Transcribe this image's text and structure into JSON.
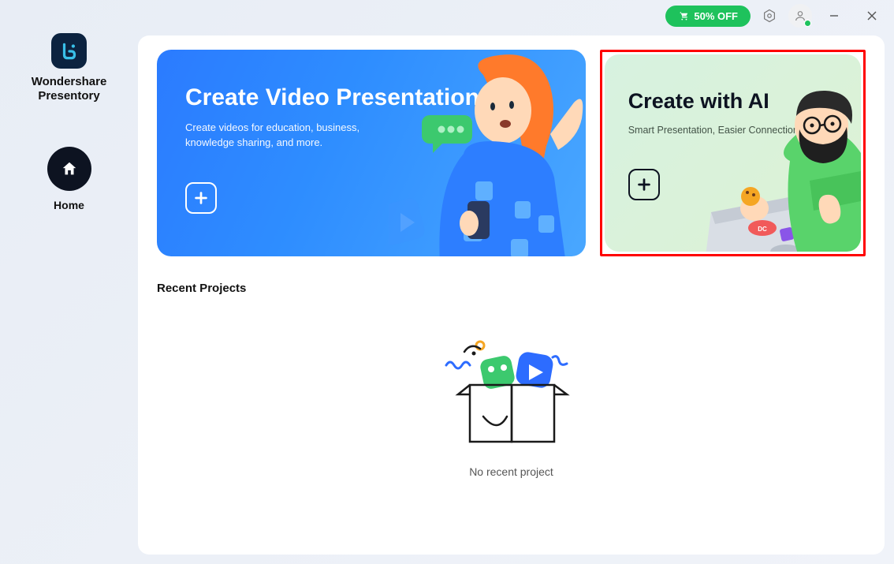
{
  "brand": {
    "line1": "Wondershare",
    "line2": "Presentory"
  },
  "header": {
    "promo_label": "50% OFF"
  },
  "nav": {
    "home_label": "Home"
  },
  "cards": {
    "video": {
      "title": "Create Video Presentation",
      "subtitle": "Create videos for education, business, knowledge sharing, and more."
    },
    "ai": {
      "title": "Create with AI",
      "subtitle": "Smart Presentation, Easier Connection."
    }
  },
  "recent": {
    "section_title": "Recent Projects",
    "empty_text": "No recent project"
  }
}
